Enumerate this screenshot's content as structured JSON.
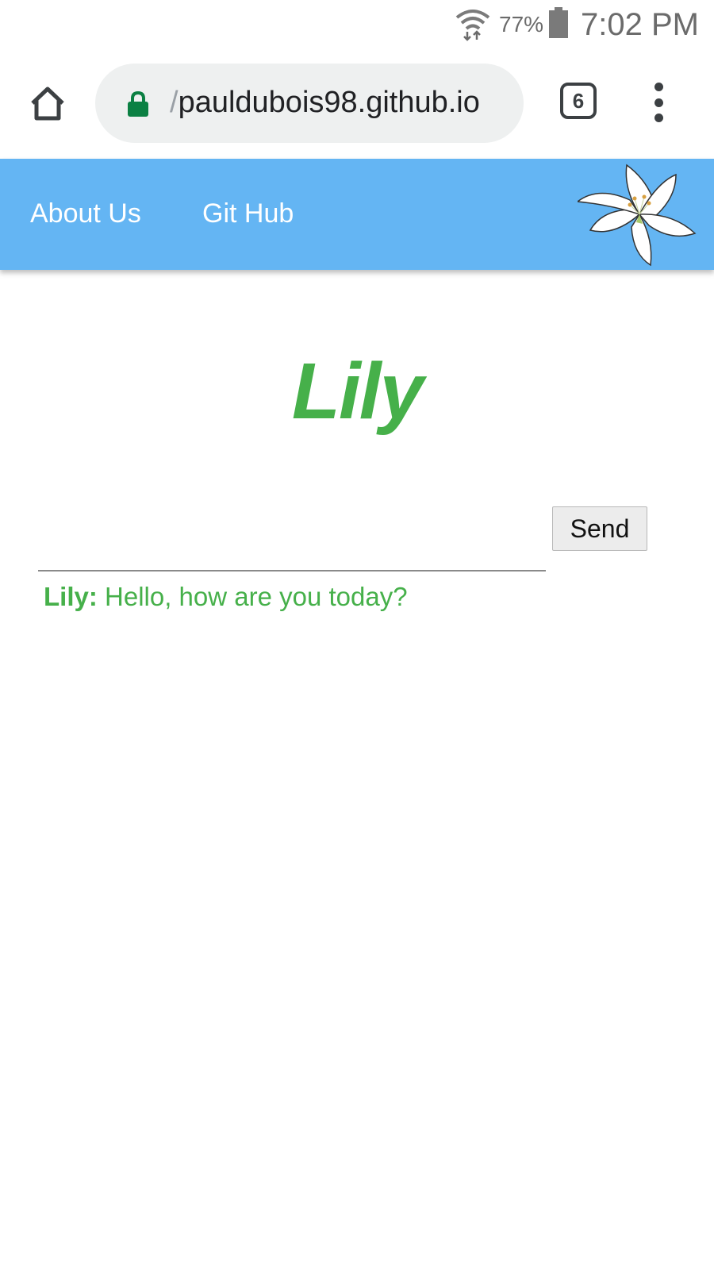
{
  "status_bar": {
    "battery_percent": "77%",
    "time": "7:02 PM"
  },
  "browser": {
    "url_prefix": "/",
    "url": "pauldubois98.github.io",
    "tab_count": "6"
  },
  "nav": {
    "items": [
      {
        "label": "About Us"
      },
      {
        "label": "Git Hub"
      }
    ]
  },
  "main": {
    "title": "Lily",
    "input_value": "",
    "send_label": "Send",
    "messages": [
      {
        "speaker": "Lily:",
        "text": " Hello, how are you today?"
      }
    ]
  },
  "colors": {
    "nav_background": "#64b5f3",
    "accent_green": "#46b04a",
    "lock_green": "#0b8043"
  }
}
